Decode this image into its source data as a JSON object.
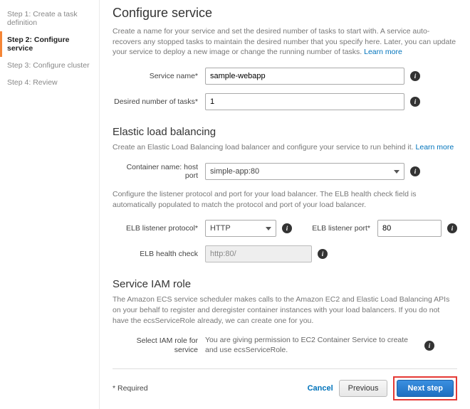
{
  "sidebar": {
    "steps": [
      "Step 1: Create a task definition",
      "Step 2: Configure service",
      "Step 3: Configure cluster",
      "Step 4: Review"
    ]
  },
  "section1": {
    "heading": "Configure service",
    "desc": "Create a name for your service and set the desired number of tasks to start with. A service auto-recovers any stopped tasks to maintain the desired number that you specify here. Later, you can update your service to deploy a new image or change the running number of tasks. ",
    "learn": "Learn more",
    "service_name_label": "Service name*",
    "service_name_value": "sample-webapp",
    "desired_tasks_label": "Desired number of tasks*",
    "desired_tasks_value": "1"
  },
  "section2": {
    "heading": "Elastic load balancing",
    "desc": "Create an Elastic Load Balancing load balancer and configure your service to run behind it. ",
    "learn": "Learn more",
    "container_label": "Container name: host port",
    "container_value": "simple-app:80",
    "desc2": "Configure the listener protocol and port for your load balancer. The ELB health check field is automatically populated to match the protocol and port of your load balancer.",
    "protocol_label": "ELB listener protocol*",
    "protocol_value": "HTTP",
    "port_label": "ELB listener port*",
    "port_value": "80",
    "health_label": "ELB health check",
    "health_value": "http:80/"
  },
  "section3": {
    "heading": "Service IAM role",
    "desc": "The Amazon ECS service scheduler makes calls to the Amazon EC2 and Elastic Load Balancing APIs on your behalf to register and deregister container instances with your load balancers. If you do not have the ecsServiceRole already, we can create one for you.",
    "role_label": "Select IAM role for service",
    "role_text": "You are giving permission to EC2 Container Service to create and use ecsServiceRole."
  },
  "footer": {
    "required": "* Required",
    "cancel": "Cancel",
    "previous": "Previous",
    "next": "Next step"
  }
}
